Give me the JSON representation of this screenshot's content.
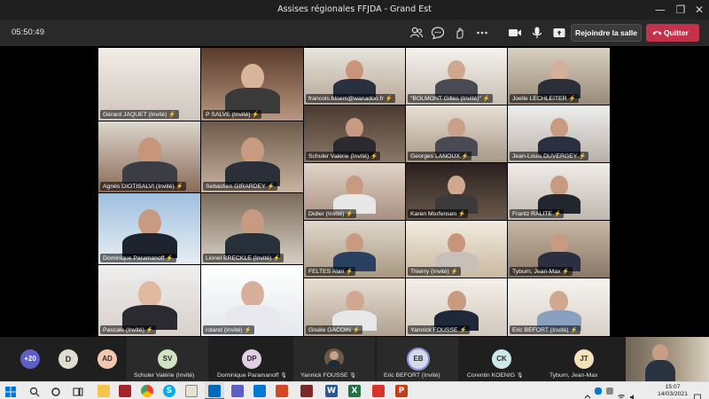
{
  "window": {
    "title": "Assises régionales FFJDA - Grand Est",
    "minimize": "—",
    "maximize": "❐",
    "close": "✕"
  },
  "toolbar": {
    "timer": "05:50:49",
    "icons": [
      "people-icon",
      "chat-icon",
      "reactions-icon",
      "more-icon",
      "camera-icon",
      "mic-icon",
      "share-icon"
    ],
    "join_room_label": "Rejoindre la salle",
    "leave_label": "Quitter"
  },
  "participants": [
    "Gérard JAQUET (Invité)",
    "P SALVE (Invité)",
    "francois.bloem@wanadoo.fr",
    "\"BOLMONT Gilles (Invité)\"",
    "Joelle LECHLEITER",
    "Agnès DIOTISALVI (Invité)",
    "Sebastien GIRARDEY",
    "Schuler Valérie (Invité)",
    "Georges LANOUX",
    "Jean-Louis DUVERGEY",
    "Didier (Invité)",
    "Karen Morfensen",
    "Frantz RALITE",
    "Dominique Paramanoff",
    "Lionel BRECKLE (Invité)",
    "FELTES Alan",
    "Thierry (Invité)",
    "Tyburn, Jean-Max",
    "Pascale (Invité)",
    "roland (Invité)",
    "Gisèle GACOIN",
    "Yannick FOUSSE",
    "Eric BEFORT (Invité)"
  ],
  "strip": {
    "overflow_count": "+20",
    "avatars": [
      {
        "initials": "D",
        "color": "#e0ddd0"
      },
      {
        "initials": "AD",
        "color": "#f1c7b1"
      },
      {
        "initials": "SV",
        "color": "#cfe2c2",
        "name": "Schuler Valérie (Invité)"
      },
      {
        "initials": "DP",
        "color": "#e2cfe6",
        "name": "Dominique Paramanoff"
      },
      {
        "initials": "",
        "name": "Yannick FOUSSE"
      },
      {
        "initials": "EB",
        "color": "#d6dbe9",
        "name": "Eric BEFORT (Invité)"
      },
      {
        "initials": "CK",
        "color": "#cfe6ea",
        "name": "Corentin KOENIG"
      },
      {
        "initials": "JT",
        "color": "#f2e3b8",
        "name": "Tyburn, Jean-Max"
      }
    ]
  },
  "taskbar": {
    "time": "15:07",
    "date": "14/03/2021"
  },
  "colors": {
    "leave_red": "#c4314b",
    "titlebar": "#1f1f1f",
    "toolbar": "#292929",
    "strip": "#1f1f1f"
  }
}
